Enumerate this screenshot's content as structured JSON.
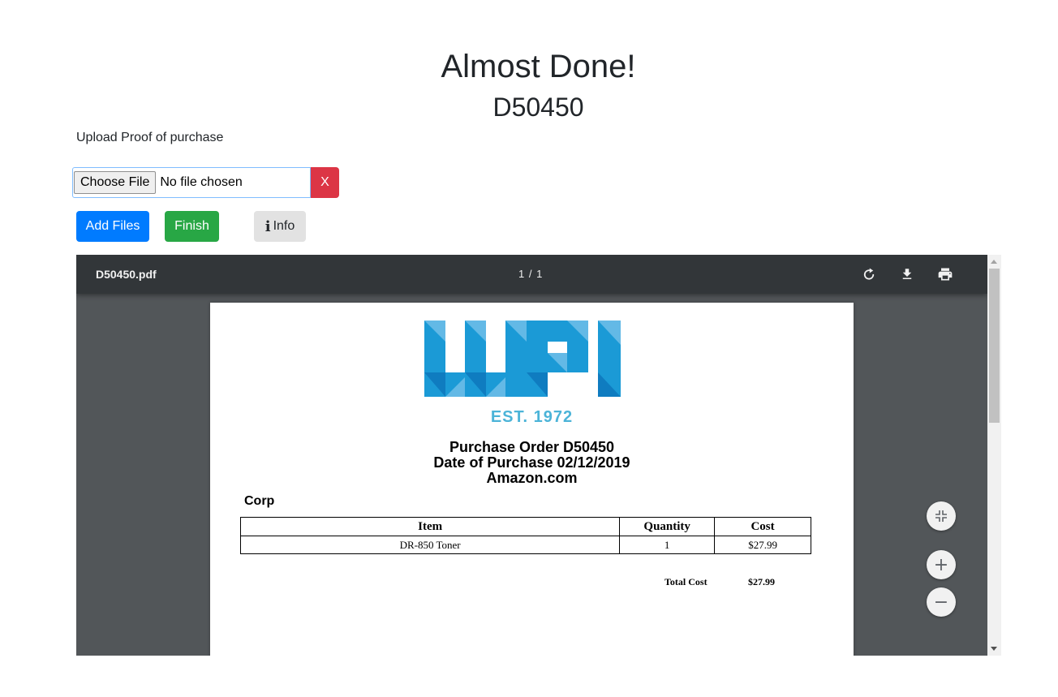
{
  "header": {
    "title": "Almost Done!",
    "order_id": "D50450"
  },
  "upload": {
    "label": "Upload Proof of purchase",
    "choose_file_label": "Choose File",
    "file_status": "No file chosen",
    "clear_label": "X"
  },
  "actions": {
    "add_files_label": "Add Files",
    "finish_label": "Finish",
    "info_label": "Info"
  },
  "pdf_viewer": {
    "file_name": "D50450.pdf",
    "page_indicator": "1 / 1",
    "toolbar_icons": [
      "rotate-icon",
      "download-icon",
      "print-icon"
    ],
    "side_controls": [
      "fit-to-page-icon",
      "zoom-in-icon",
      "zoom-out-icon"
    ]
  },
  "document": {
    "logo_text": "WPI",
    "logo_tagline": "EST. 1972",
    "po_title": "Purchase Order D50450",
    "purchase_date": "Date of Purchase 02/12/2019",
    "vendor": "Amazon.com",
    "company": "Corp",
    "columns": [
      "Item",
      "Quantity",
      "Cost"
    ],
    "rows": [
      {
        "item": "DR-850 Toner",
        "quantity": "1",
        "cost": "$27.99"
      }
    ],
    "total_label": "Total Cost",
    "total_value": "$27.99"
  },
  "colors": {
    "primary": "#007bff",
    "success": "#28a745",
    "danger": "#dc3545",
    "viewer_bg": "#525659",
    "toolbar_bg": "#323639",
    "logo_blue": "#1b9ad6"
  }
}
